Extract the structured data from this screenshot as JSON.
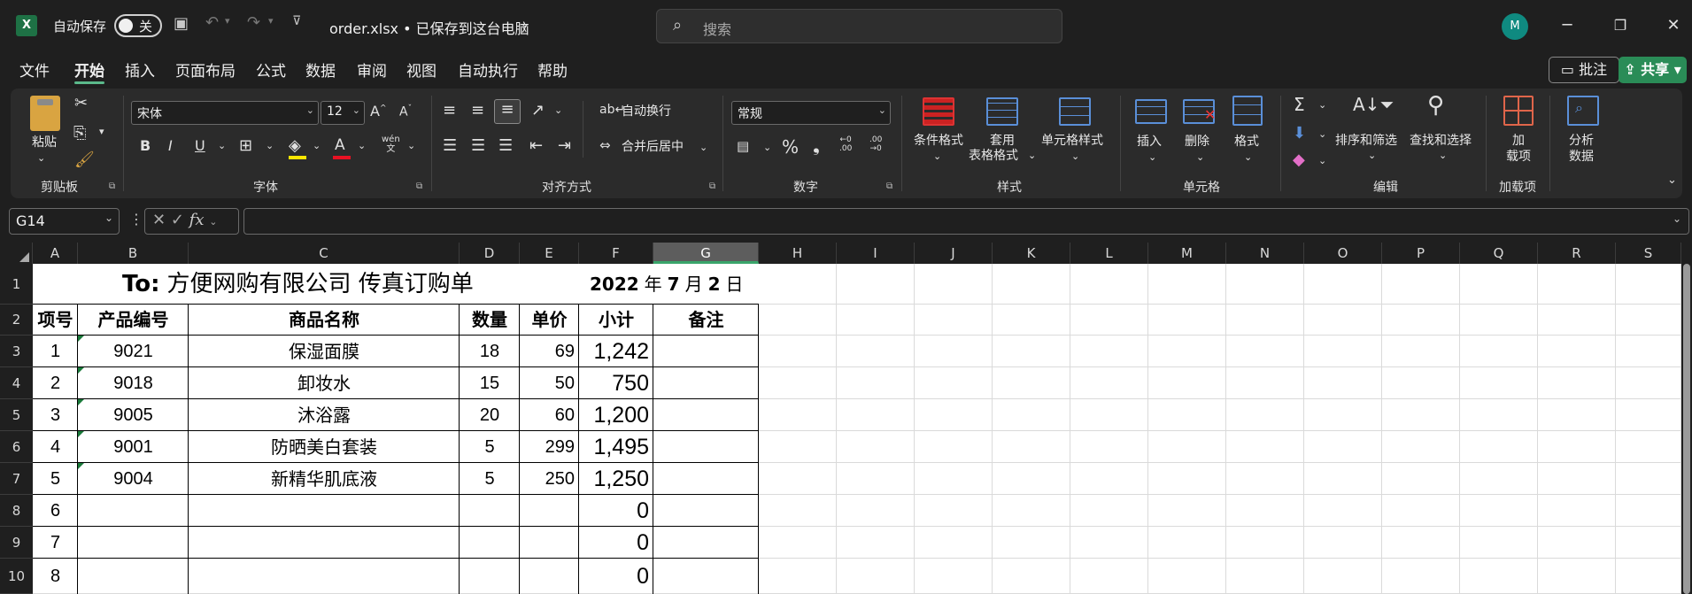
{
  "app": {
    "logo_letter": "X",
    "autosave_label": "自动保存",
    "autosave_state": "关",
    "file_title": "order.xlsx • 已保存到这台电脑",
    "search_placeholder": "搜索",
    "avatar_initial": "M"
  },
  "menu": {
    "items": [
      "文件",
      "开始",
      "插入",
      "页面布局",
      "公式",
      "数据",
      "审阅",
      "视图",
      "自动执行",
      "帮助"
    ],
    "active": "开始",
    "comment": "批注",
    "share": "共享"
  },
  "ribbon": {
    "clipboard": {
      "paste": "粘贴",
      "group": "剪贴板"
    },
    "font": {
      "name": "宋体",
      "size": "12",
      "bold": "B",
      "italic": "I",
      "underline": "U",
      "phonetic": "wén",
      "group": "字体"
    },
    "alignment": {
      "wrap": "自动换行",
      "merge": "合并后居中",
      "group": "对齐方式"
    },
    "number": {
      "format": "常规",
      "percent": "%",
      "comma": "❟",
      "inc_decimal": ".00",
      "dec_decimal": ".00",
      "group": "数字"
    },
    "styles": {
      "conditional": "条件格式",
      "table_l1": "套用",
      "table_l2": "表格格式",
      "cell_styles": "单元格样式",
      "group": "样式"
    },
    "cells": {
      "insert": "插入",
      "delete": "删除",
      "format": "格式",
      "group": "单元格"
    },
    "editing": {
      "sort": "排序和筛选",
      "find": "查找和选择",
      "group": "编辑"
    },
    "addins": {
      "l1": "加",
      "l2": "载项",
      "group": "加载项"
    },
    "analysis": {
      "l1": "分析",
      "l2": "数据"
    }
  },
  "formula_bar": {
    "name_box": "G14",
    "fx": "fx",
    "value": ""
  },
  "columns": [
    "A",
    "B",
    "C",
    "D",
    "E",
    "F",
    "G",
    "H",
    "I",
    "J",
    "K",
    "L",
    "M",
    "N",
    "O",
    "P",
    "Q",
    "R",
    "S"
  ],
  "selected_column": "G",
  "rows": [
    "1",
    "2",
    "3",
    "4",
    "5",
    "6",
    "7",
    "8",
    "9",
    "10"
  ],
  "sheet": {
    "title_to": "To:",
    "title_company": "方便网购有限公司  传真订购单",
    "date_year": "2022",
    "date_y_char": "年",
    "date_month": "7",
    "date_m_char": "月",
    "date_day": "2",
    "date_d_char": "日",
    "headers": [
      "项号",
      "产品编号",
      "商品名称",
      "数量",
      "单价",
      "小计",
      "备注"
    ],
    "data_rows": [
      [
        "1",
        "9021",
        "保湿面膜",
        "18",
        "69",
        "1,242",
        ""
      ],
      [
        "2",
        "9018",
        "卸妆水",
        "15",
        "50",
        "750",
        ""
      ],
      [
        "3",
        "9005",
        "沐浴露",
        "20",
        "60",
        "1,200",
        ""
      ],
      [
        "4",
        "9001",
        "防晒美白套装",
        "5",
        "299",
        "1,495",
        ""
      ],
      [
        "5",
        "9004",
        "新精华肌底液",
        "5",
        "250",
        "1,250",
        ""
      ],
      [
        "6",
        "",
        "",
        "",
        "",
        "0",
        ""
      ],
      [
        "7",
        "",
        "",
        "",
        "",
        "0",
        ""
      ],
      [
        "8",
        "",
        "",
        "",
        "",
        "0",
        ""
      ]
    ]
  }
}
